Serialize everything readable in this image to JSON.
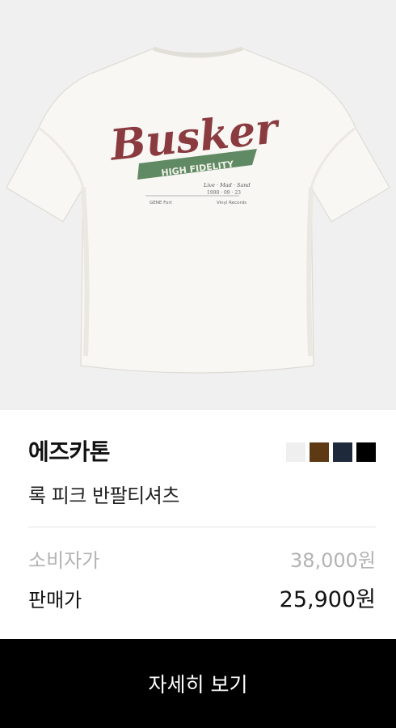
{
  "product": {
    "image_alt": "white short sleeve t-shirt back print",
    "print_text": {
      "script": "Busker",
      "banner": "HIGH FIDELITY",
      "small_right_1": "Live · Mad · Sand",
      "small_right_2": "1998 · 09 · 23",
      "small_left": "GENE Fort",
      "small_right_3": "Vinyl Records"
    },
    "brand": "에즈카톤",
    "name": "록 피크 반팔티셔츠",
    "swatches": [
      {
        "name": "white",
        "color": "#efefef"
      },
      {
        "name": "brown",
        "color": "#5e3a14"
      },
      {
        "name": "navy",
        "color": "#1e2a3c"
      },
      {
        "name": "black",
        "color": "#000000"
      }
    ],
    "retail_label": "소비자가",
    "retail_price": "38,000원",
    "sale_label": "판매가",
    "sale_price": "25,900원"
  },
  "cta_label": "자세히 보기"
}
